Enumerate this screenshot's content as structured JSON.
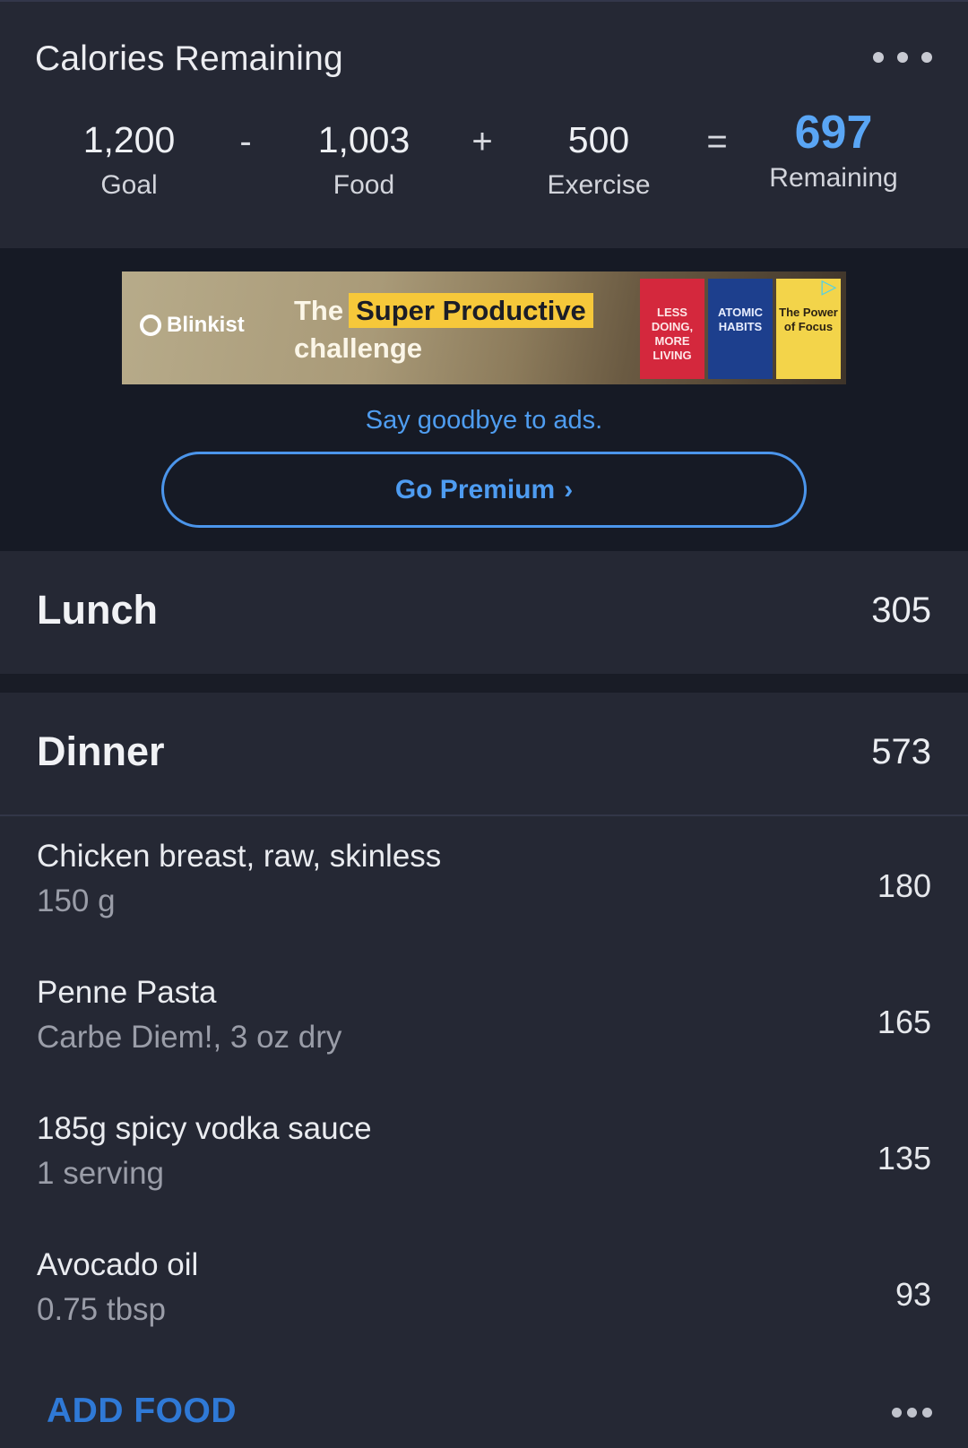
{
  "calories": {
    "title": "Calories Remaining",
    "more_icon": "more-horizontal-icon",
    "goal": {
      "value": "1,200",
      "label": "Goal"
    },
    "minus": "-",
    "food": {
      "value": "1,003",
      "label": "Food"
    },
    "plus": "+",
    "exercise": {
      "value": "500",
      "label": "Exercise"
    },
    "equals": "=",
    "remaining": {
      "value": "697",
      "label": "Remaining"
    },
    "accent_color": "#5aa6f5"
  },
  "ad": {
    "brand": "Blinkist",
    "headline_prefix": "The",
    "headline_highlight": "Super Productive",
    "headline_line2": "challenge",
    "books": [
      "LESS DOING, MORE LIVING",
      "ATOMIC HABITS",
      "The Power of Focus"
    ],
    "remove_ads_text": "Say goodbye to ads.",
    "premium_button": "Go Premium",
    "premium_chevron": "›"
  },
  "meals": {
    "lunch": {
      "name": "Lunch",
      "total": "305"
    },
    "dinner": {
      "name": "Dinner",
      "total": "573",
      "items": [
        {
          "name": "Chicken breast, raw, skinless",
          "serving": "150 g",
          "calories": "180"
        },
        {
          "name": "Penne Pasta",
          "serving": "Carbe Diem!, 3 oz dry",
          "calories": "165"
        },
        {
          "name": "185g spicy vodka sauce",
          "serving": "1 serving",
          "calories": "135"
        },
        {
          "name": "Avocado oil",
          "serving": "0.75 tbsp",
          "calories": "93"
        }
      ],
      "add_food": "ADD FOOD"
    }
  }
}
